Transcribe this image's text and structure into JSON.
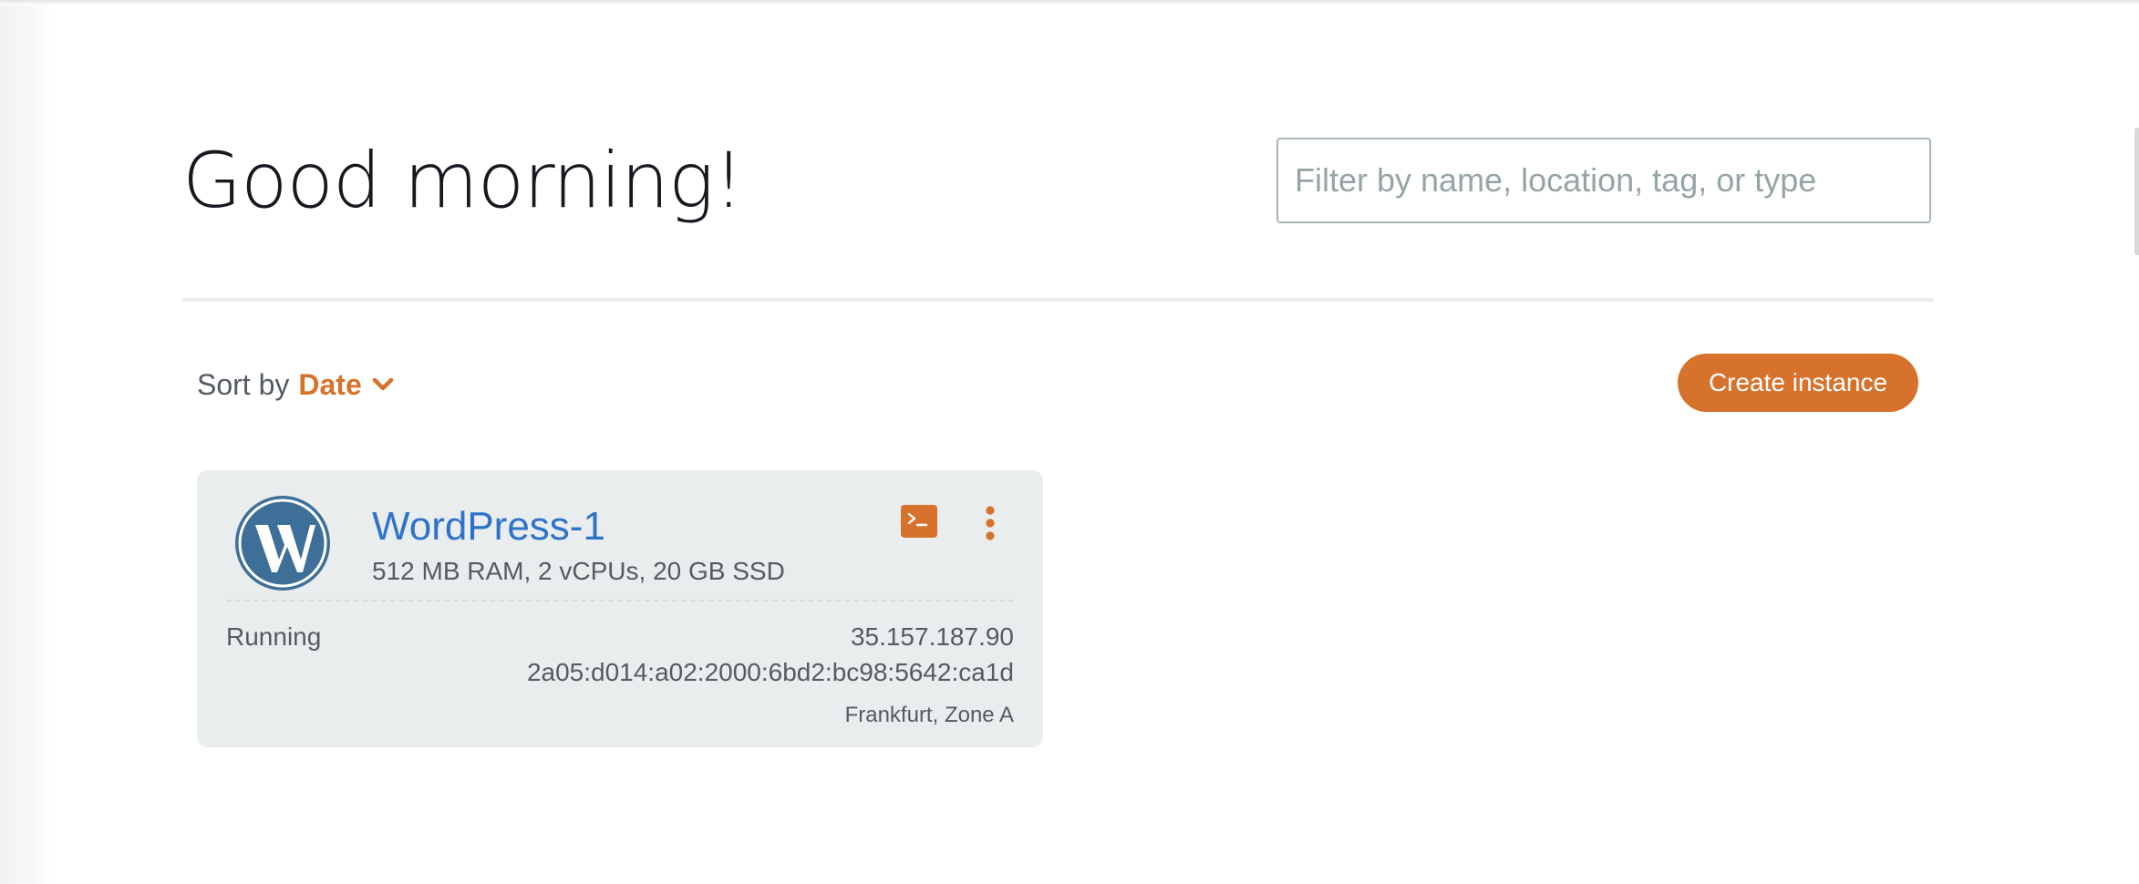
{
  "header": {
    "greeting": "Good morning!",
    "filter_placeholder": "Filter by name, location, tag, or type"
  },
  "toolbar": {
    "sort_label": "Sort by",
    "sort_value": "Date",
    "create_label": "Create instance"
  },
  "instances": [
    {
      "name": "WordPress-1",
      "spec": "512 MB RAM, 2 vCPUs, 20 GB SSD",
      "status": "Running",
      "ipv4": "35.157.187.90",
      "ipv6": "2a05:d014:a02:2000:6bd2:bc98:5642:ca1d",
      "location": "Frankfurt, Zone A",
      "icon": "wordpress-icon"
    }
  ],
  "colors": {
    "accent": "#d7722c",
    "link": "#2e73c9",
    "card_background": "#eaeded",
    "wordpress_blue": "#3d6f99"
  }
}
